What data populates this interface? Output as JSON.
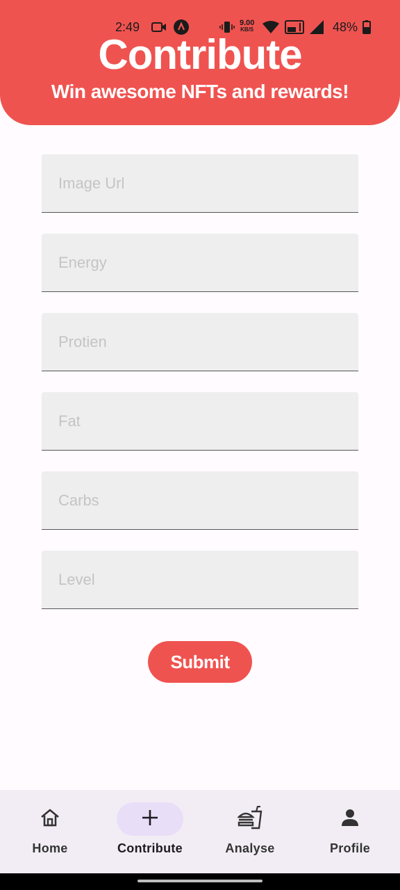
{
  "status_bar": {
    "time": "2:49",
    "net_speed_value": "9.00",
    "net_speed_unit": "KB/S",
    "battery": "48%"
  },
  "header": {
    "title": "Contribute",
    "subtitle": "Win awesome NFTs and rewards!"
  },
  "form": {
    "fields": [
      {
        "placeholder": "Image Url",
        "value": ""
      },
      {
        "placeholder": "Energy",
        "value": ""
      },
      {
        "placeholder": "Protien",
        "value": ""
      },
      {
        "placeholder": "Fat",
        "value": ""
      },
      {
        "placeholder": "Carbs",
        "value": ""
      },
      {
        "placeholder": "Level",
        "value": ""
      }
    ],
    "submit_label": "Submit"
  },
  "nav": {
    "items": [
      {
        "label": "Home",
        "icon": "home-icon"
      },
      {
        "label": "Contribute",
        "icon": "plus-icon",
        "active": true
      },
      {
        "label": "Analyse",
        "icon": "food-icon"
      },
      {
        "label": "Profile",
        "icon": "person-icon"
      }
    ]
  },
  "colors": {
    "accent": "#ef5350",
    "background": "#fffbfe",
    "field_bg": "#eeeeee",
    "nav_bg": "#f2edf4",
    "nav_active_pill": "#e8def8"
  }
}
